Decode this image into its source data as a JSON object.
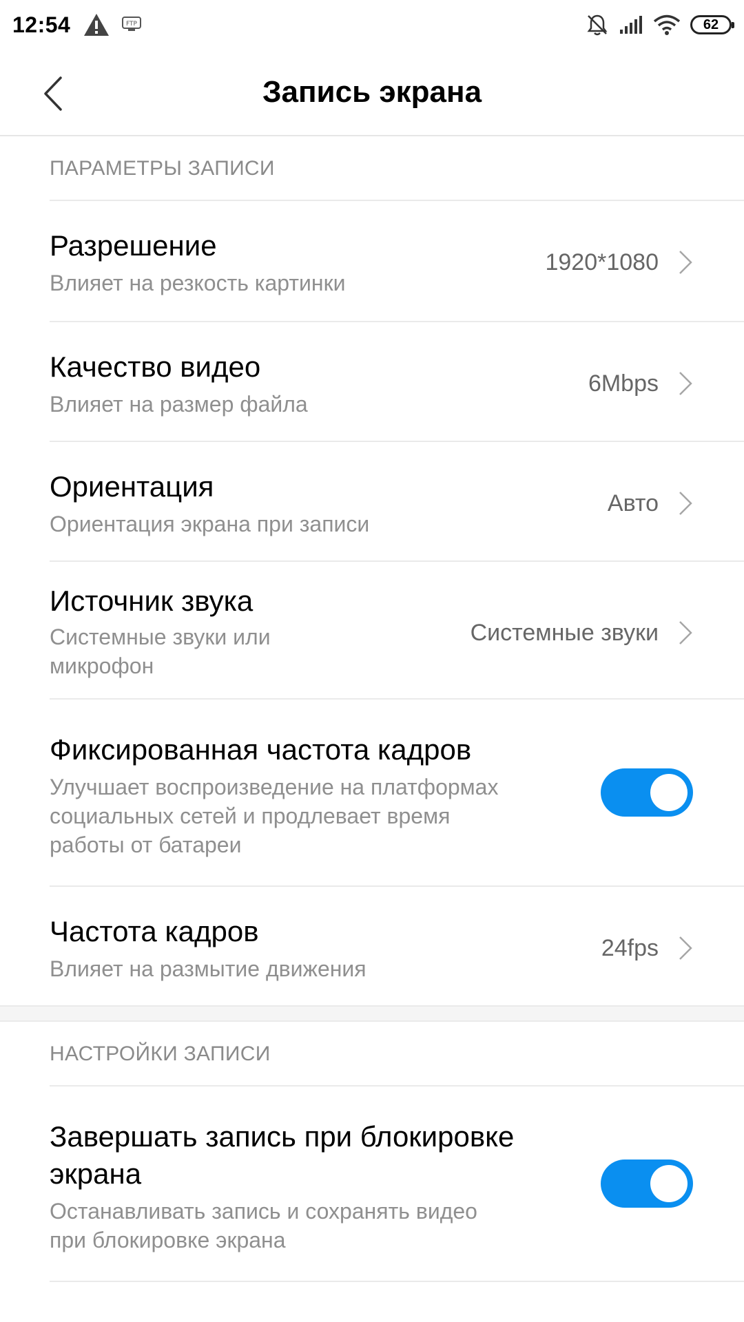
{
  "status_bar": {
    "time": "12:54",
    "battery": "62",
    "icons": [
      "warning-icon",
      "ftp-icon",
      "bell-off-icon",
      "signal-icon",
      "wifi-icon",
      "battery-icon"
    ]
  },
  "header": {
    "title": "Запись экрана"
  },
  "sections": {
    "recording_params": {
      "label": "ПАРАМЕТРЫ ЗАПИСИ",
      "items": [
        {
          "title": "Разрешение",
          "subtitle": "Влияет на резкость картинки",
          "value": "1920*1080"
        },
        {
          "title": "Качество видео",
          "subtitle": "Влияет на размер файла",
          "value": "6Mbps"
        },
        {
          "title": "Ориентация",
          "subtitle": "Ориентация экрана при записи",
          "value": "Авто"
        },
        {
          "title": "Источник звука",
          "subtitle_line1": "Системные звуки или",
          "subtitle_line2": "микрофон",
          "value": "Системные звуки"
        },
        {
          "title": "Фиксированная частота кадров",
          "subtitle_line1": "Улучшает воспроизведение на платформах",
          "subtitle_line2": "социальных сетей и продлевает время",
          "subtitle_line3": "работы от батареи",
          "toggle_on": true
        },
        {
          "title": "Частота кадров",
          "subtitle": "Влияет на размытие движения",
          "value": "24fps"
        }
      ]
    },
    "recording_settings": {
      "label": "НАСТРОЙКИ ЗАПИСИ",
      "items": [
        {
          "title_line1": "Завершать запись при блокировке",
          "title_line2": "экрана",
          "subtitle_line1": "Останавливать запись и сохранять видео",
          "subtitle_line2": "при блокировке экрана",
          "toggle_on": true
        }
      ]
    }
  },
  "colors": {
    "accent": "#0a8ff0",
    "secondary_text": "#8f8f8f",
    "value_text": "#666666",
    "divider": "#eaeaea"
  }
}
